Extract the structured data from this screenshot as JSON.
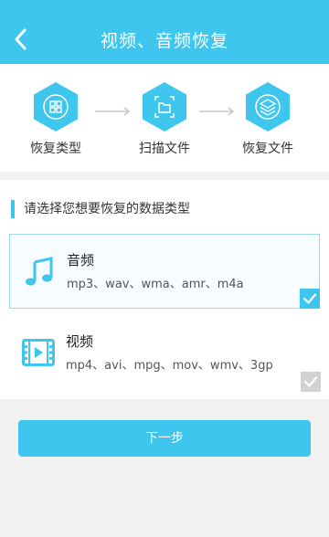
{
  "header": {
    "title": "视频、音频恢复",
    "background": "#3ec6ef"
  },
  "steps": [
    {
      "label": "恢复类型",
      "icon": "category-grid-icon"
    },
    {
      "label": "扫描文件",
      "icon": "scan-file-icon"
    },
    {
      "label": "恢复文件",
      "icon": "layers-icon"
    }
  ],
  "section": {
    "title": "请选择您想要恢复的数据类型"
  },
  "options": [
    {
      "name": "音频",
      "formats": "mp3、wav、wma、amr、m4a",
      "icon": "music-note-icon",
      "checked": true
    },
    {
      "name": "视频",
      "formats": "mp4、avi、mpg、mov、wmv、3gp",
      "icon": "video-film-icon",
      "checked": false
    }
  ],
  "next_button": {
    "label": "下一步"
  },
  "colors": {
    "accent": "#3ec6ef",
    "check_active": "#3ec6ef",
    "check_inactive": "#cccccc"
  }
}
